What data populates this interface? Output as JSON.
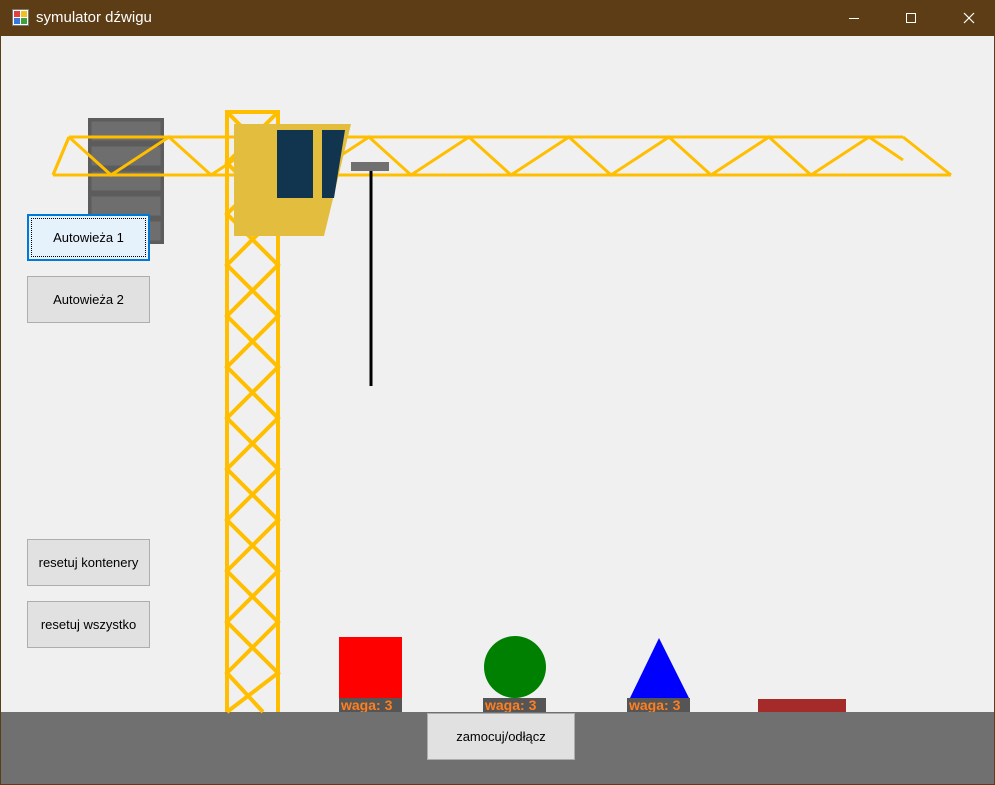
{
  "window": {
    "title": "symulator dźwigu",
    "icon": "app-icon",
    "controls": [
      "minimize-icon",
      "maximize-icon",
      "close-icon"
    ]
  },
  "colors": {
    "titlebar": "#5c3d16",
    "client_background": "#f0f0f0",
    "ground": "#707070",
    "crane_frame": "#ffbf00",
    "cabin": "#e3bd3d",
    "cabin_window": "#11344f",
    "counterweight": "#5c5c5c",
    "hook_rope": "#000000",
    "weight_label_text": "#ff7f1f"
  },
  "buttons": {
    "autotower1": "Autowieża 1",
    "autotower2": "Autowieża 2",
    "reset_containers": "resetuj kontenery",
    "reset_all": "resetuj wszystko",
    "attach_detach": "zamocuj/odłącz"
  },
  "containers": [
    {
      "shape": "square",
      "color": "#ff0000",
      "label": "waga: 3"
    },
    {
      "shape": "circle",
      "color": "#008000",
      "label": "waga: 3"
    },
    {
      "shape": "triangle",
      "color": "#0000ff",
      "label": "waga: 3"
    },
    {
      "shape": "platform",
      "color": "#a52a2a"
    }
  ]
}
